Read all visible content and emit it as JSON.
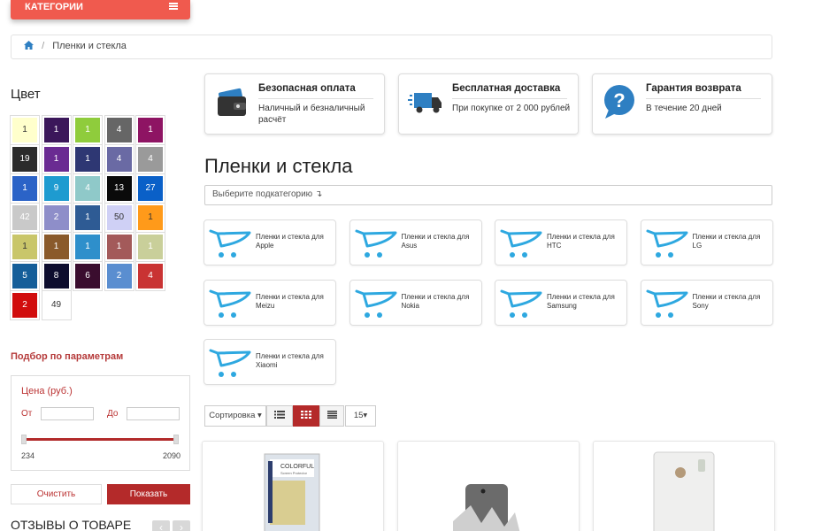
{
  "header": {
    "categories_label": "КАТЕГОРИИ"
  },
  "breadcrumb": {
    "current": "Пленки и стекла"
  },
  "filters": {
    "color_title": "Цвет",
    "swatches": [
      {
        "count": "1",
        "color": "#ffffcc",
        "text": "#333"
      },
      {
        "count": "1",
        "color": "#3b175a",
        "text": "#fff"
      },
      {
        "count": "1",
        "color": "#8fcc3c",
        "text": "#fff"
      },
      {
        "count": "4",
        "color": "#666666",
        "text": "#fff"
      },
      {
        "count": "1",
        "color": "#8e1463",
        "text": "#fff"
      },
      {
        "count": "19",
        "color": "#2b2b2b",
        "text": "#fff"
      },
      {
        "count": "1",
        "color": "#6a2b92",
        "text": "#fff"
      },
      {
        "count": "1",
        "color": "#2e3773",
        "text": "#fff"
      },
      {
        "count": "4",
        "color": "#6a6aa4",
        "text": "#fff"
      },
      {
        "count": "4",
        "color": "#9a9a9a",
        "text": "#fff"
      },
      {
        "count": "1",
        "color": "#2b63c7",
        "text": "#fff"
      },
      {
        "count": "9",
        "color": "#1e9bd0",
        "text": "#fff"
      },
      {
        "count": "4",
        "color": "#8fc9c9",
        "text": "#fff"
      },
      {
        "count": "13",
        "color": "#0a0a0a",
        "text": "#fff"
      },
      {
        "count": "27",
        "color": "#0a60c8",
        "text": "#fff"
      },
      {
        "count": "42",
        "color": "#c9c9c9",
        "text": "#fff"
      },
      {
        "count": "2",
        "color": "#8e8ec9",
        "text": "#fff"
      },
      {
        "count": "1",
        "color": "#2e5b94",
        "text": "#fff"
      },
      {
        "count": "50",
        "color": "#cfd0f5",
        "text": "#333"
      },
      {
        "count": "1",
        "color": "#ff9a1a",
        "text": "#333"
      },
      {
        "count": "1",
        "color": "#c9c66a",
        "text": "#333"
      },
      {
        "count": "1",
        "color": "#8a5a2b",
        "text": "#fff"
      },
      {
        "count": "1",
        "color": "#2e8fcb",
        "text": "#fff"
      },
      {
        "count": "1",
        "color": "#a35a5a",
        "text": "#fff"
      },
      {
        "count": "1",
        "color": "#c9cf9a",
        "text": "#fff"
      },
      {
        "count": "5",
        "color": "#155e99",
        "text": "#fff"
      },
      {
        "count": "8",
        "color": "#0d0d2e",
        "text": "#fff"
      },
      {
        "count": "6",
        "color": "#3a0d2e",
        "text": "#fff"
      },
      {
        "count": "2",
        "color": "#5a8ed0",
        "text": "#fff"
      },
      {
        "count": "4",
        "color": "#c93333",
        "text": "#fff"
      },
      {
        "count": "2",
        "color": "#d10d0d",
        "text": "#fff"
      },
      {
        "count": "49",
        "color": "#ffffff",
        "text": "#333"
      }
    ],
    "params_title": "Подбор по параметрам",
    "price_label": "Цена (руб.)",
    "from_label": "От",
    "to_label": "До",
    "min": "234",
    "max": "2090",
    "clear": "Очистить",
    "show": "Показать"
  },
  "reviews_title": "ОТЗЫВЫ О ТОВАРЕ",
  "features": [
    {
      "title": "Безопасная оплата",
      "desc": "Наличный и безналичный расчёт",
      "icon": "wallet-icon"
    },
    {
      "title": "Бесплатная доставка",
      "desc": "При покупке от 2 000 рублей",
      "icon": "delivery-truck-icon"
    },
    {
      "title": "Гарантия возврата",
      "desc": "В течение 20 дней",
      "icon": "question-bubble-icon"
    }
  ],
  "page_title": "Пленки и стекла",
  "subcategory_select": "Выберите подкатегорию ↴",
  "subcategories": [
    "Пленки и стекла для Apple",
    "Пленки и стекла для Asus",
    "Пленки и стекла для HTC",
    "Пленки и стекла для LG",
    "Пленки и стекла для Meizu",
    "Пленки и стекла для Nokia",
    "Пленки и стекла для Samsung",
    "Пленки и стекла для Sony",
    "Пленки и стекла для Xiaomi"
  ],
  "toolbar": {
    "sort_label": "Сортировка",
    "per_page": "15"
  },
  "accent": "#b42a2a",
  "brand_red": "#f05a4e",
  "cart_blue": "#2ea8e0"
}
